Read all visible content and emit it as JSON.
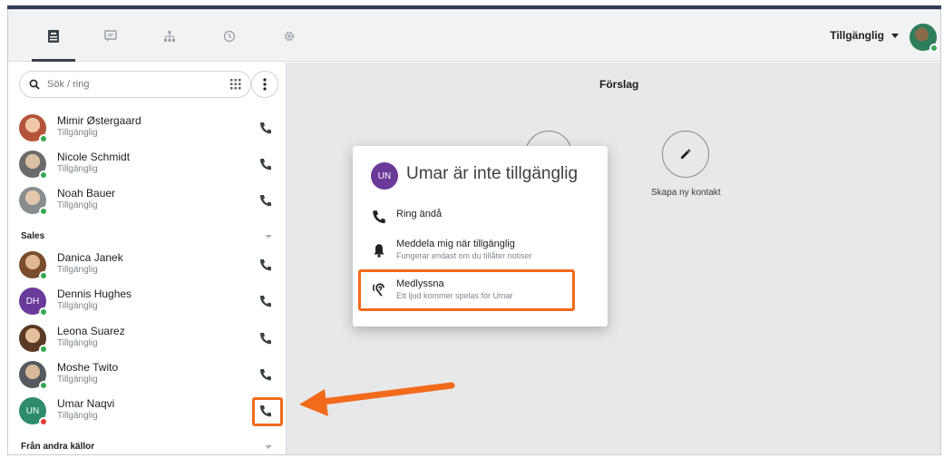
{
  "header": {
    "tabs": [
      {
        "icon": "contacts-icon",
        "active": true
      },
      {
        "icon": "chat-icon",
        "active": false
      },
      {
        "icon": "org-chart-icon",
        "active": false
      },
      {
        "icon": "history-icon",
        "active": false
      },
      {
        "icon": "settings-icon",
        "active": false
      }
    ],
    "status_label": "Tillgänglig"
  },
  "search": {
    "placeholder": "Sök / ring"
  },
  "contacts": [
    {
      "name": "Mimir Østergaard",
      "status": "Tillgänglig"
    },
    {
      "name": "Nicole Schmidt",
      "status": "Tillgänglig"
    },
    {
      "name": "Noah Bauer",
      "status": "Tillgänglig"
    }
  ],
  "groups": {
    "sales": "Sales",
    "other_sources": "Från andra källor"
  },
  "sales_contacts": [
    {
      "name": "Danica Janek",
      "status": "Tillgänglig"
    },
    {
      "name": "Dennis Hughes",
      "status": "Tillgänglig",
      "initials": "DH"
    },
    {
      "name": "Leona Suarez",
      "status": "Tillgänglig"
    },
    {
      "name": "Moshe Twito",
      "status": "Tillgänglig"
    },
    {
      "name": "Umar Naqvi",
      "status": "Tillgänglig",
      "initials": "UN"
    }
  ],
  "main": {
    "title": "Förslag",
    "create_contact": "Skapa ny kontakt"
  },
  "dialog": {
    "avatar_initials": "UN",
    "title": "Umar är inte tillgänglig",
    "options": [
      {
        "label": "Ring ändå",
        "sub": ""
      },
      {
        "label": "Meddela mig när tillgänglig",
        "sub": "Fungerar endast om du tillåter notiser"
      },
      {
        "label": "Medlyssna",
        "sub": "Ett ljud kommer spelas för Umar"
      }
    ]
  },
  "colors": {
    "accent_orange": "#f26a1b",
    "available_green": "#34a853",
    "busy_red": "#e53935",
    "dialog_avatar": "#6a3a9a"
  }
}
